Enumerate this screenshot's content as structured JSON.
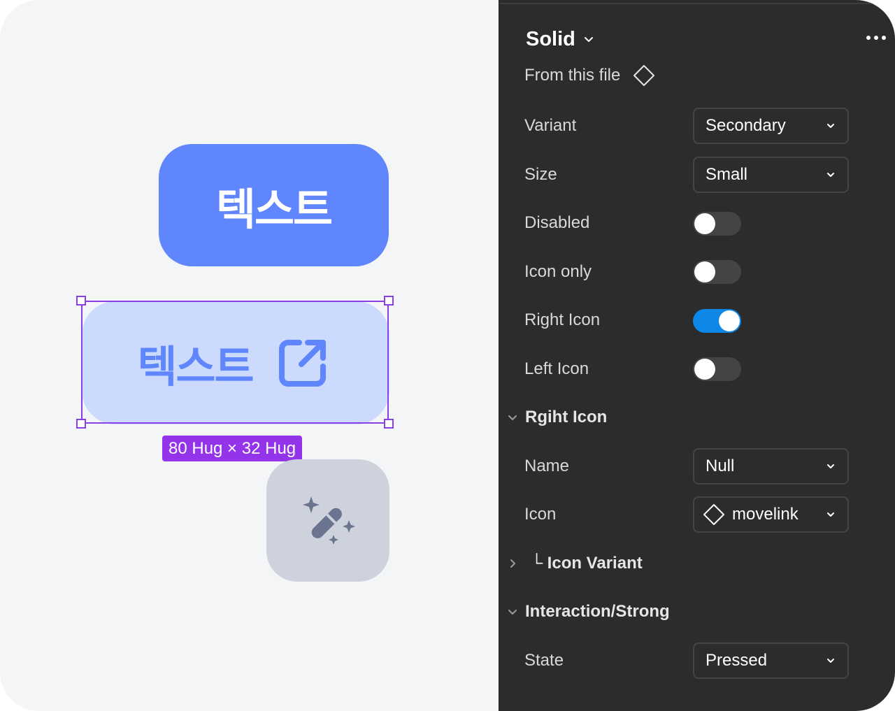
{
  "canvas": {
    "primary_button": {
      "label": "텍스트"
    },
    "secondary_button": {
      "label": "텍스트",
      "icon": "external-link-icon"
    },
    "selection_size": "80 Hug × 32 Hug",
    "icon_button": {
      "icon": "magic-wand-icon"
    }
  },
  "panel": {
    "component_name": "Solid",
    "source": "From this file",
    "props": {
      "variant": {
        "label": "Variant",
        "value": "Secondary"
      },
      "size": {
        "label": "Size",
        "value": "Small"
      },
      "disabled": {
        "label": "Disabled",
        "on": false
      },
      "icon_only": {
        "label": "Icon only",
        "on": false
      },
      "right_icon": {
        "label": "Right Icon",
        "on": true
      },
      "left_icon": {
        "label": "Left Icon",
        "on": false
      }
    },
    "right_icon_section": {
      "title": "Rgiht Icon",
      "name": {
        "label": "Name",
        "value": "Null"
      },
      "icon": {
        "label": "Icon",
        "value": "movelink"
      },
      "icon_variant": "└ Icon Variant"
    },
    "interaction_section": {
      "title": "Interaction/Strong",
      "state": {
        "label": "State",
        "value": "Pressed"
      }
    }
  },
  "colors": {
    "primary": "#5f86fd",
    "secondary_bg": "#ccdafe",
    "selection": "#8b3fe6",
    "toggle_on": "#0d88e8",
    "panel_bg": "#2c2c2c"
  }
}
